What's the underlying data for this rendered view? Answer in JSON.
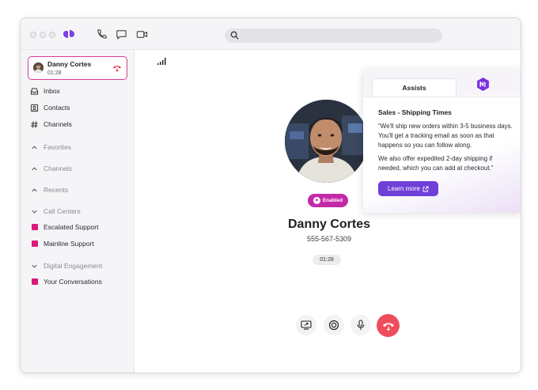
{
  "sidebar": {
    "active_call": {
      "name": "Danny Cortes",
      "time": "01:28"
    },
    "items": [
      {
        "label": "Inbox"
      },
      {
        "label": "Contacts"
      },
      {
        "label": "Channels"
      }
    ],
    "sections": [
      {
        "label": "Favorites"
      },
      {
        "label": "Channels"
      },
      {
        "label": "Recents"
      },
      {
        "label": "Call Centers"
      }
    ],
    "call_centers": [
      {
        "label": "Escalated Support"
      },
      {
        "label": "Mainline Support"
      }
    ],
    "digital_engagement": {
      "label": "Digital Engagement",
      "items": [
        {
          "label": "Your Conversations"
        }
      ]
    }
  },
  "call": {
    "badge": "Enabled",
    "name": "Danny Cortes",
    "phone": "555-567-5309",
    "timer": "01:28"
  },
  "assist": {
    "tab_label": "Assists",
    "title": "Sales - Shipping Times",
    "paragraph1": "“We'll ship new orders within 3-5 business days. You'll get a tracking email as soon as that happens so you can follow along.",
    "paragraph2": "We also offer expedited 2-day shipping if needed, which you can add at checkout.”",
    "button": "Learn more"
  },
  "colors": {
    "accent_pink": "#d83a96",
    "badge_magenta": "#c42aa8",
    "hangup_red": "#ef4d5c",
    "button_purple": "#6f3fd8",
    "square_pink": "#d81b7a"
  }
}
